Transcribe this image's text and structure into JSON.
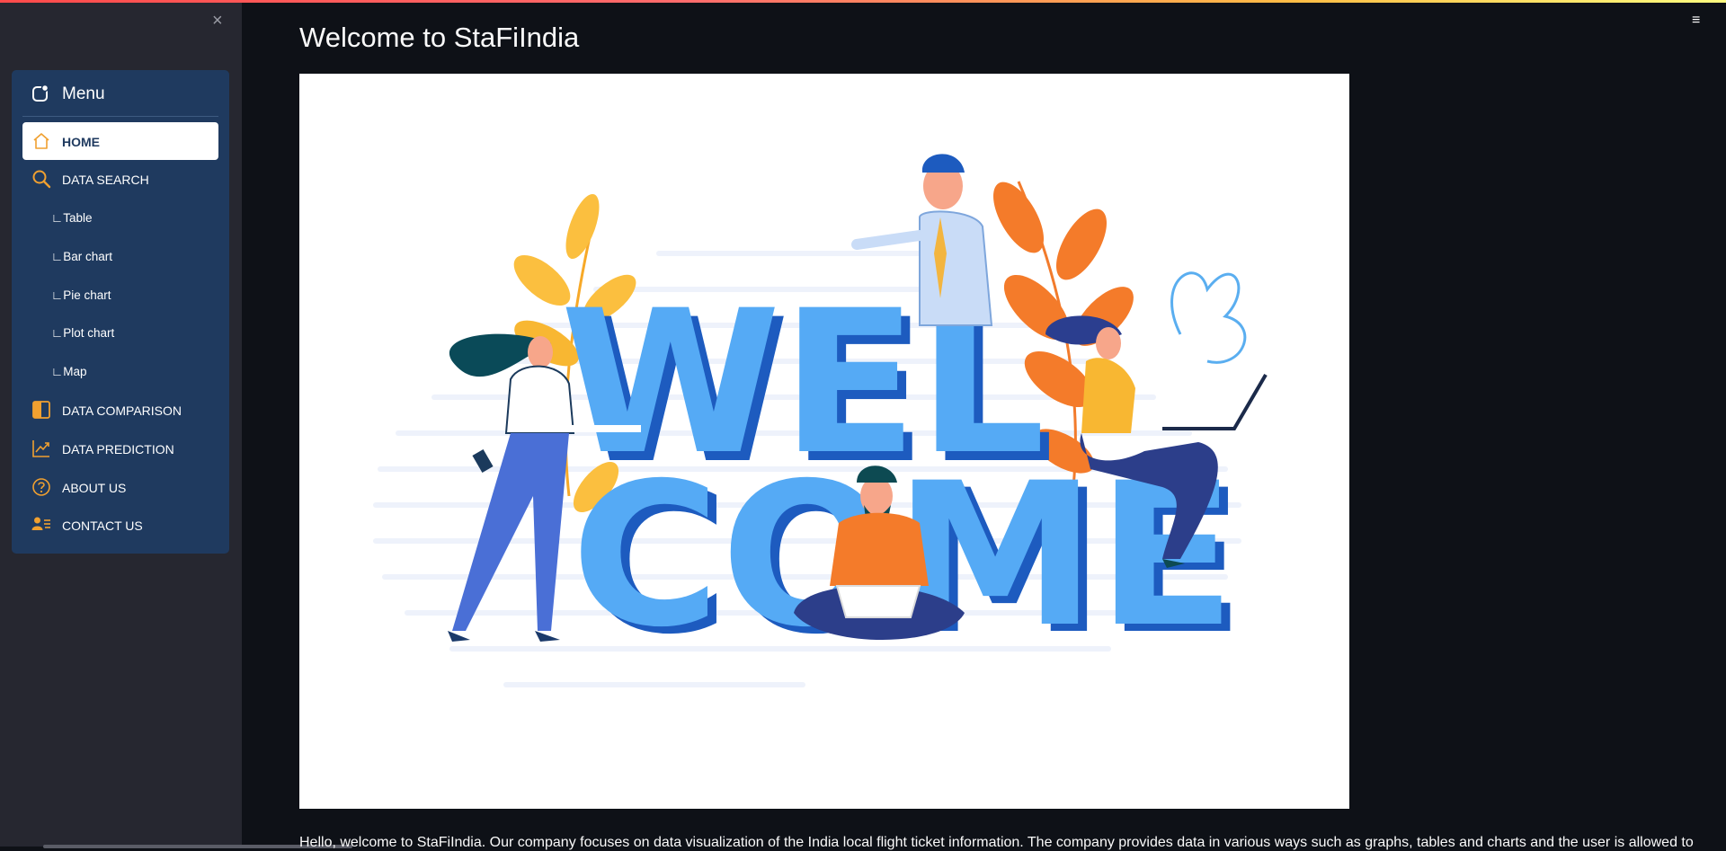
{
  "app": {
    "title": "Welcome to StaFiIndia",
    "intro_text": "Hello, welcome to StaFiIndia. Our company focuses on data visualization of the India local flight ticket information. The company provides data in various ways such as graphs, tables and charts and the user is allowed to"
  },
  "sidebar": {
    "close_label": "×",
    "menu_title": "Menu",
    "items": [
      {
        "label": "HOME",
        "icon": "home-icon",
        "active": true
      },
      {
        "label": "DATA SEARCH",
        "icon": "search-icon"
      },
      {
        "label": "∟Table",
        "icon": null
      },
      {
        "label": "∟Bar chart",
        "icon": null
      },
      {
        "label": "∟Pie chart",
        "icon": null
      },
      {
        "label": "∟Plot chart",
        "icon": null
      },
      {
        "label": "∟Map",
        "icon": null
      },
      {
        "label": "DATA COMPARISON",
        "icon": "layout-split-icon"
      },
      {
        "label": "DATA PREDICTION",
        "icon": "graph-up-icon"
      },
      {
        "label": "ABOUT US",
        "icon": "question-circle-icon"
      },
      {
        "label": "CONTACT US",
        "icon": "person-lines-icon"
      }
    ]
  },
  "hero": {
    "image_letters_line1": "WEL",
    "image_letters_line2": "COME"
  },
  "toolbar": {
    "hamburger_label": "≡"
  },
  "colors": {
    "accent": "#ff4b4b",
    "menu_bg": "#1f3a5f",
    "icon_orange": "#f0a030",
    "sidebar_bg": "#262730",
    "main_bg": "#0e1117"
  }
}
